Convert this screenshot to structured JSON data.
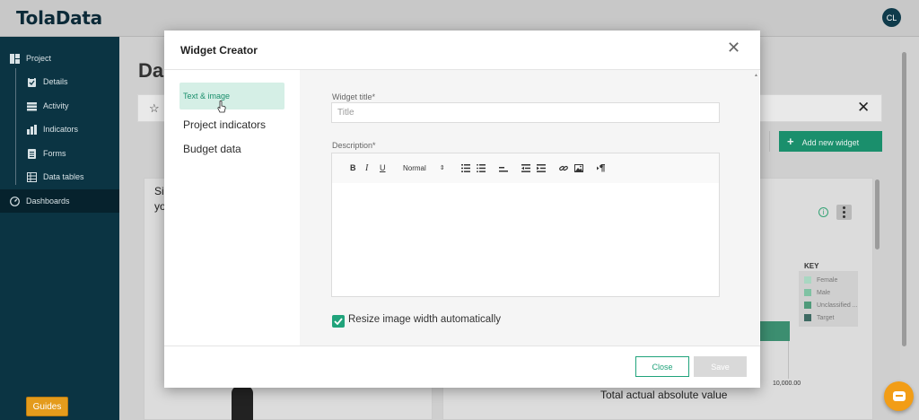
{
  "app": {
    "logo": "TolaData",
    "user_initials": "CL"
  },
  "sidebar": {
    "items": [
      {
        "label": "Project",
        "icon": "project-icon",
        "level": "top"
      },
      {
        "label": "Details",
        "icon": "clipboard-icon",
        "level": "sub"
      },
      {
        "label": "Activity",
        "icon": "stack-icon",
        "level": "sub"
      },
      {
        "label": "Indicators",
        "icon": "bar-chart-icon",
        "level": "sub"
      },
      {
        "label": "Forms",
        "icon": "form-icon",
        "level": "sub"
      },
      {
        "label": "Data tables",
        "icon": "table-icon",
        "level": "sub"
      },
      {
        "label": "Dashboards",
        "icon": "dashboard-icon",
        "level": "top",
        "active": true
      }
    ],
    "guides_label": "Guides"
  },
  "background": {
    "page_title": "Da",
    "add_widget_label": "Add new widget",
    "card_title": "Si yo",
    "legend_title": "KEY",
    "legend": [
      {
        "label": "Female",
        "color": "#a9d7c2"
      },
      {
        "label": "Male",
        "color": "#7fc2a3"
      },
      {
        "label": "Unclassified ...",
        "color": "#4f9a7a"
      },
      {
        "label": "Target",
        "color": "#3e6a63"
      }
    ],
    "axis_tick": "10,000.00",
    "axis_title": "Total actual absolute value"
  },
  "modal": {
    "title": "Widget Creator",
    "tabs": [
      {
        "label": "Text & image",
        "active": true
      },
      {
        "label": "Project indicators",
        "active": false
      },
      {
        "label": "Budget data",
        "active": false
      }
    ],
    "widget_title_label": "Widget title*",
    "widget_title_placeholder": "Title",
    "description_label": "Description*",
    "toolbar": {
      "bold": "B",
      "italic": "I",
      "underline": "U",
      "format": "Normal"
    },
    "resize_label": "Resize image width automatically",
    "resize_checked": true,
    "close_label": "Close",
    "save_label": "Save"
  },
  "colors": {
    "accent": "#20a37b",
    "sidebar": "#0b3443",
    "guides": "#e49b1c"
  }
}
